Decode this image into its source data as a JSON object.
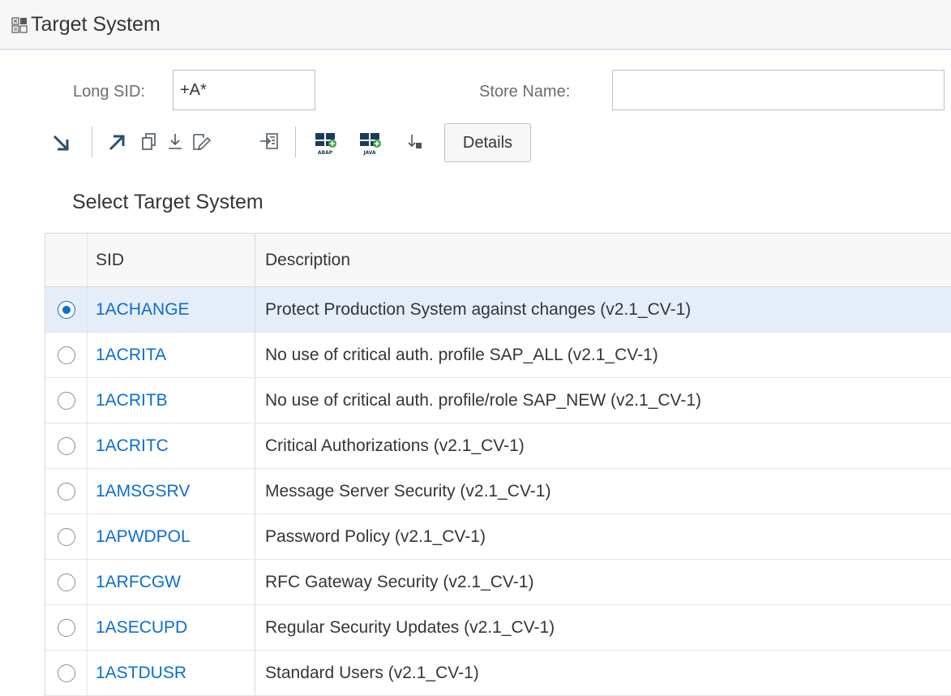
{
  "window": {
    "title": "Target System"
  },
  "filters": {
    "long_sid_label": "Long SID:",
    "long_sid_value": "+A*",
    "store_name_label": "Store Name:",
    "store_name_value": ""
  },
  "toolbar": {
    "icons": [
      "collapse-arrow-icon",
      "expand-arrow-icon",
      "copy-icon",
      "download-icon",
      "edit-icon",
      "import-icon",
      "add-abap-system-icon",
      "add-java-system-icon",
      "sort-icon"
    ],
    "abap_label": "ABAP",
    "java_label": "JAVA",
    "details_label": "Details"
  },
  "section": {
    "title": "Select Target System"
  },
  "table": {
    "columns": [
      "SID",
      "Description"
    ],
    "rows": [
      {
        "sid": "1ACHANGE",
        "description": "Protect Production System against changes (v2.1_CV-1)",
        "selected": true
      },
      {
        "sid": "1ACRITA",
        "description": "No use of critical auth. profile SAP_ALL (v2.1_CV-1)",
        "selected": false
      },
      {
        "sid": "1ACRITB",
        "description": "No use of critical auth. profile/role SAP_NEW (v2.1_CV-1)",
        "selected": false
      },
      {
        "sid": "1ACRITC",
        "description": "Critical Authorizations (v2.1_CV-1)",
        "selected": false
      },
      {
        "sid": "1AMSGSRV",
        "description": "Message Server Security (v2.1_CV-1)",
        "selected": false
      },
      {
        "sid": "1APWDPOL",
        "description": "Password Policy (v2.1_CV-1)",
        "selected": false
      },
      {
        "sid": "1ARFCGW",
        "description": "RFC Gateway Security (v2.1_CV-1)",
        "selected": false
      },
      {
        "sid": "1ASECUPD",
        "description": "Regular Security Updates (v2.1_CV-1)",
        "selected": false
      },
      {
        "sid": "1ASTDUSR",
        "description": "Standard Users (v2.1_CV-1)",
        "selected": false
      }
    ]
  },
  "colors": {
    "link": "#0a6ed1",
    "selected_row": "#e5eef8",
    "header_bg": "#f7f7f7"
  }
}
